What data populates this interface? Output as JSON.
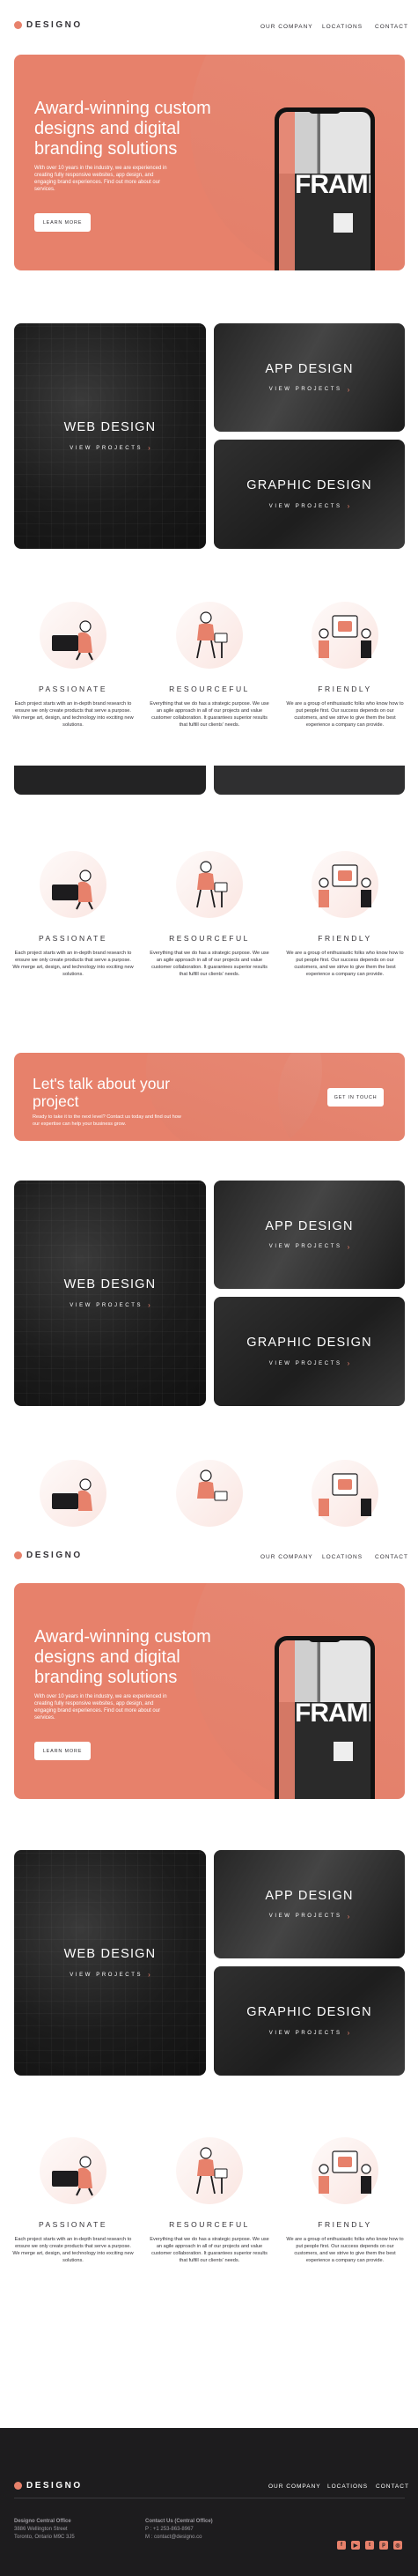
{
  "brand": {
    "name": "DESIGNO",
    "accent": "#E7816B",
    "dark": "#1D1C1E"
  },
  "nav": {
    "our_company": "OUR COMPANY",
    "locations": "LOCATIONS",
    "contact": "CONTACT"
  },
  "hero": {
    "title": "Award-winning custom designs and digital branding solutions",
    "body": "With over 10 years in the industry, we are experienced in creating fully responsive websites, app design, and engaging brand experiences. Find out more about our services.",
    "button": "LEARN MORE",
    "phone_text": "FRAME"
  },
  "categories": {
    "web": "WEB DESIGN",
    "app": "APP DESIGN",
    "graphic": "GRAPHIC DESIGN",
    "link": "VIEW PROJECTS"
  },
  "features": [
    {
      "title": "PASSIONATE",
      "icon": "passionate-illustration",
      "body": "Each project starts with an in-depth brand research to ensure we only create products that serve a purpose. We merge art, design, and technology into exciting new solutions."
    },
    {
      "title": "RESOURCEFUL",
      "icon": "resourceful-illustration",
      "body": "Everything that we do has a strategic purpose. We use an agile approach in all of our projects and value customer collaboration. It guarantees superior results that fulfill our clients' needs."
    },
    {
      "title": "FRIENDLY",
      "icon": "friendly-illustration",
      "body": "We are a group of enthusiastic folks who know how to put people first. Our success depends on our customers, and we strive to give them the best experience a company can provide."
    }
  ],
  "cta": {
    "title": "Let's talk about your project",
    "body": "Ready to take it to the next level? Contact us today and find out how our expertise can help your business grow.",
    "button": "GET IN TOUCH"
  },
  "footer": {
    "office_title": "Designo Central Office",
    "office_line1": "3886 Wellington Street",
    "office_line2": "Toronto, Ontario M9C 3J5",
    "contact_title": "Contact Us (Central Office)",
    "phone": "P : +1 253-863-8967",
    "email": "M : contact@designo.co",
    "socials": [
      "facebook-icon",
      "youtube-icon",
      "twitter-icon",
      "pinterest-icon",
      "instagram-icon"
    ]
  }
}
